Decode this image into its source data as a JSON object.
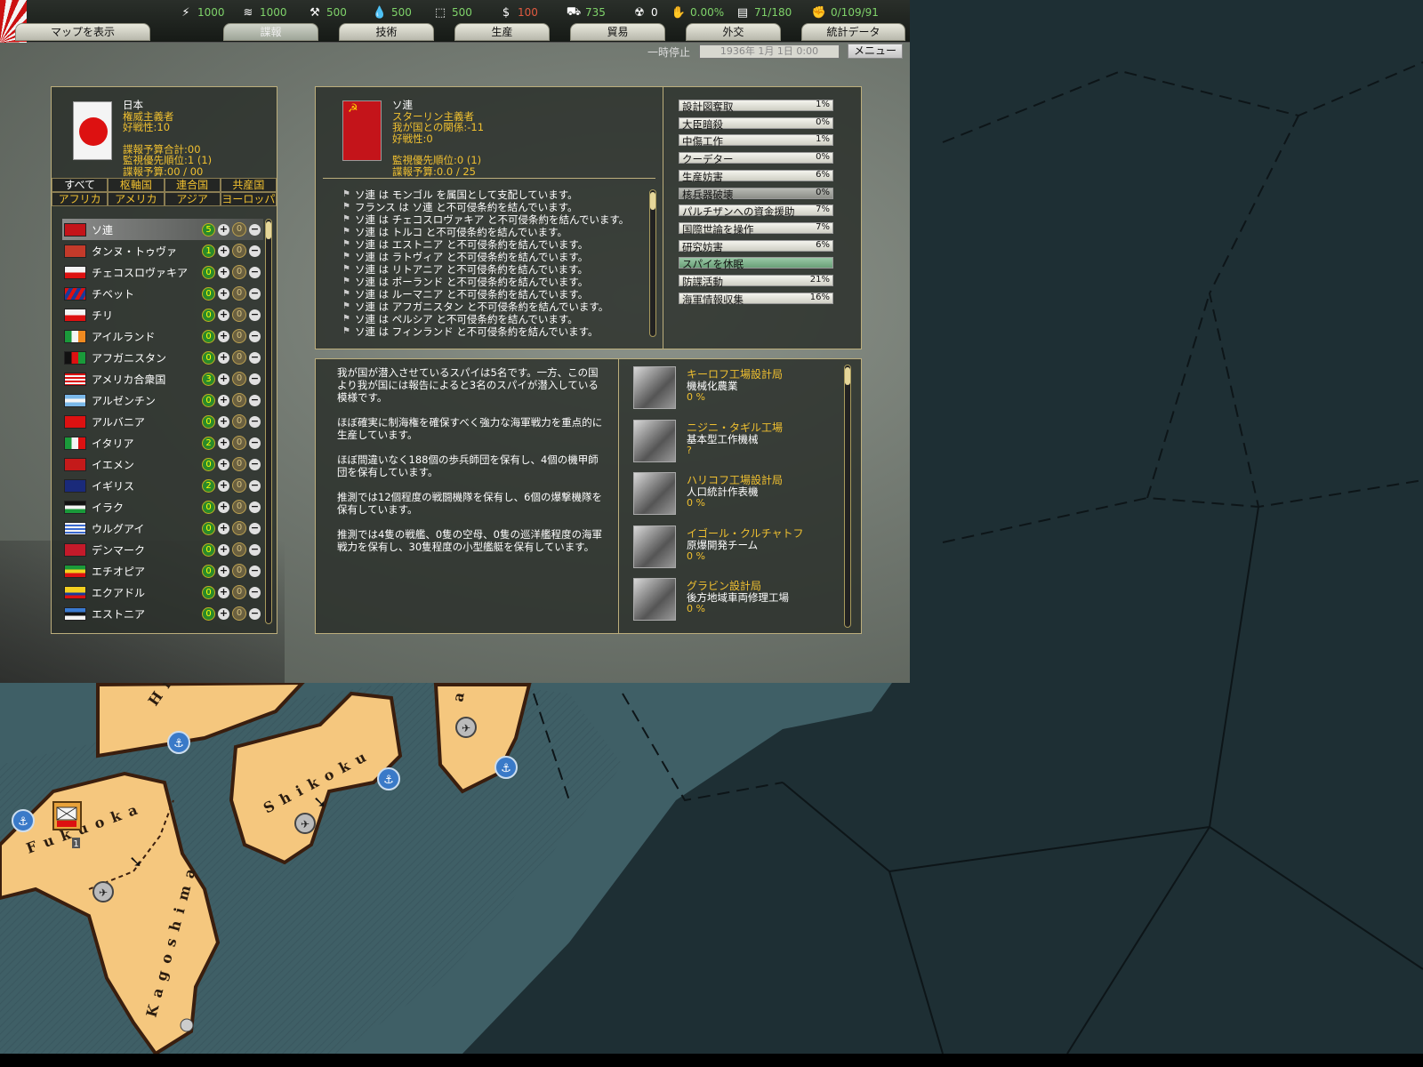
{
  "resources": [
    {
      "icon": "⚡",
      "name": "energy-icon",
      "value": "1000",
      "color": "green"
    },
    {
      "icon": "≋",
      "name": "metal-icon",
      "value": "1000",
      "color": "green"
    },
    {
      "icon": "⚒",
      "name": "rare-materials-icon",
      "value": "500",
      "color": "green"
    },
    {
      "icon": "💧",
      "name": "oil-icon",
      "value": "500",
      "color": "green"
    },
    {
      "icon": "⬚",
      "name": "supplies-icon",
      "value": "500",
      "color": "green"
    },
    {
      "icon": "$",
      "name": "money-icon",
      "value": "100",
      "color": "red"
    },
    {
      "icon": "⛟",
      "name": "manpower-icon",
      "value": "735",
      "color": "green"
    },
    {
      "icon": "☢",
      "name": "nuclear-icon",
      "value": "0",
      "color": "white"
    },
    {
      "icon": "✋",
      "name": "dissent-icon",
      "value": "0.00%",
      "color": "green"
    },
    {
      "icon": "▤",
      "name": "transport-icon",
      "value": "71/180",
      "color": "green"
    },
    {
      "icon": "✊",
      "name": "officers-icon",
      "value": "0/109/91",
      "color": "green"
    }
  ],
  "tabs": [
    "マップを表示",
    "諜報",
    "技術",
    "生産",
    "貿易",
    "外交",
    "統計データ"
  ],
  "subbar": {
    "pause": "一時停止",
    "date": "1936年 1月 1日 0:00",
    "menu": "メニュー"
  },
  "self": {
    "name": "日本",
    "ideology": "権威主義者",
    "belligerence": "好戦性:10",
    "budget_total": "諜報予算合計:00",
    "priority": "監視優先順位:1 (1)",
    "budget": "諜報予算:00 / 00"
  },
  "filters": [
    "すべて",
    "枢軸国",
    "連合国",
    "共産国",
    "アフリカ",
    "アメリカ",
    "アジア",
    "ヨーロッパ"
  ],
  "countries": [
    {
      "name": "ソ連",
      "spies": "5",
      "budget": "0",
      "selected": true,
      "flag": "linear-gradient(#c4141a,#c4141a)"
    },
    {
      "name": "タンヌ・トゥヴァ",
      "spies": "1",
      "budget": "0",
      "flag": "linear-gradient(#c43a2a,#c43a2a)"
    },
    {
      "name": "チェコスロヴァキア",
      "spies": "0",
      "budget": "0",
      "flag": "linear-gradient(#f4f4f4 50%,#d11 50%)"
    },
    {
      "name": "チベット",
      "spies": "0",
      "budget": "0",
      "flag": "repeating-linear-gradient(120deg,#d11 0 4px,#1a3a9a 4px 8px)"
    },
    {
      "name": "チリ",
      "spies": "0",
      "budget": "0",
      "flag": "linear-gradient(#f4f4f4 50%,#d11 50%)"
    },
    {
      "name": "アイルランド",
      "spies": "0",
      "budget": "0",
      "flag": "linear-gradient(90deg,#1a9a3a 33%,#f4f4f4 33% 66%,#f08a20 66%)"
    },
    {
      "name": "アフガニスタン",
      "spies": "0",
      "budget": "0",
      "flag": "linear-gradient(90deg,#111 33%,#d11 33% 66%,#1a9a3a 66%)"
    },
    {
      "name": "アメリカ合衆国",
      "spies": "3",
      "budget": "0",
      "flag": "repeating-linear-gradient(#d11 0 2px,#f4f4f4 2px 4px)"
    },
    {
      "name": "アルゼンチン",
      "spies": "0",
      "budget": "0",
      "flag": "linear-gradient(#7ab8e8 33%,#f4f4f4 33% 66%,#7ab8e8 66%)"
    },
    {
      "name": "アルバニア",
      "spies": "0",
      "budget": "0",
      "flag": "linear-gradient(#d11,#d11)"
    },
    {
      "name": "イタリア",
      "spies": "2",
      "budget": "0",
      "flag": "linear-gradient(90deg,#1a9a3a 33%,#f4f4f4 33% 66%,#d11 66%)"
    },
    {
      "name": "イエメン",
      "spies": "0",
      "budget": "0",
      "flag": "linear-gradient(#c41a1a,#c41a1a)"
    },
    {
      "name": "イギリス",
      "spies": "2",
      "budget": "0",
      "flag": "linear-gradient(#1a2a7a,#1a2a7a)"
    },
    {
      "name": "イラク",
      "spies": "0",
      "budget": "0",
      "flag": "linear-gradient(#111 33%,#f4f4f4 33% 66%,#1a9a3a 66%)"
    },
    {
      "name": "ウルグアイ",
      "spies": "0",
      "budget": "0",
      "flag": "repeating-linear-gradient(#f4f4f4 0 2px,#3a6ad0 2px 4px)"
    },
    {
      "name": "デンマーク",
      "spies": "0",
      "budget": "0",
      "flag": "linear-gradient(#c41a2a,#c41a2a)"
    },
    {
      "name": "エチオピア",
      "spies": "0",
      "budget": "0",
      "flag": "linear-gradient(#1a9a3a 33%,#f4d020 33% 66%,#d11 66%)"
    },
    {
      "name": "エクアドル",
      "spies": "0",
      "budget": "0",
      "flag": "linear-gradient(#f4d020 50%,#1a3a9a 50% 75%,#d11 75%)"
    },
    {
      "name": "エストニア",
      "spies": "0",
      "budget": "0",
      "flag": "linear-gradient(#3a7ad0 33%,#111 33% 66%,#f4f4f4 66%)"
    }
  ],
  "target": {
    "name": "ソ連",
    "ideology": "スターリン主義者",
    "relation": "我が国との関係:-11",
    "belligerence": "好戦性:0",
    "priority": "監視優先順位:0 (1)",
    "budget": "諜報予算:0.0 / 25"
  },
  "events": [
    "ソ連 は モンゴル を属国として支配しています。",
    "フランス は ソ連 と不可侵条約を結んでいます。",
    "ソ連 は チェコスロヴァキア と不可侵条約を結んでいます。",
    "ソ連 は トルコ と不可侵条約を結んでいます。",
    "ソ連 は エストニア と不可侵条約を結んでいます。",
    "ソ連 は ラトヴィア と不可侵条約を結んでいます。",
    "ソ連 は リトアニア と不可侵条約を結んでいます。",
    "ソ連 は ポーランド と不可侵条約を結んでいます。",
    "ソ連 は ルーマニア と不可侵条約を結んでいます。",
    "ソ連 は アフガニスタン と不可侵条約を結んでいます。",
    "ソ連 は ペルシア と不可侵条約を結んでいます。",
    "ソ連 は フィンランド と不可侵条約を結んでいます。"
  ],
  "missions": [
    {
      "label": "設計図奪取",
      "value": "1%",
      "style": "normal"
    },
    {
      "label": "大臣暗殺",
      "value": "0%",
      "style": "normal"
    },
    {
      "label": "中傷工作",
      "value": "1%",
      "style": "normal"
    },
    {
      "label": "クーデター",
      "value": "0%",
      "style": "normal"
    },
    {
      "label": "生産妨害",
      "value": "6%",
      "style": "normal"
    },
    {
      "label": "核兵器破壊",
      "value": "0%",
      "style": "dark"
    },
    {
      "label": "パルチザンへの資金援助",
      "value": "7%",
      "style": "normal"
    },
    {
      "label": "国際世論を操作",
      "value": "7%",
      "style": "normal"
    },
    {
      "label": "研究妨害",
      "value": "6%",
      "style": "normal"
    },
    {
      "label": "スパイを休眠",
      "value": "",
      "style": "green"
    },
    {
      "label": "防諜活動",
      "value": "21%",
      "style": "normal"
    },
    {
      "label": "海軍情報収集",
      "value": "16%",
      "style": "normal"
    }
  ],
  "report": [
    "我が国が潜入させているスパイは5名です。一方、この国より我が国には報告によると3名のスパイが潜入している模様です。",
    "ほぼ確実に制海権を確保すべく強力な海軍戦力を重点的に生産しています。",
    "ほぼ間違いなく188個の歩兵師団を保有し、4個の機甲師団を保有しています。",
    "推測では12個程度の戦闘機隊を保有し、6個の爆撃機隊を保有しています。",
    "推測では4隻の戦艦、0隻の空母、0隻の巡洋艦程度の海軍戦力を保有し、30隻程度の小型艦艇を保有しています。"
  ],
  "techs": [
    {
      "name": "キーロフ工場設計局",
      "desc": "機械化農業",
      "pct": "0 %"
    },
    {
      "name": "ニジニ・タギル工場",
      "desc": "基本型工作機械",
      "pct": "?"
    },
    {
      "name": "ハリコフ工場設計局",
      "desc": "人口統計作表機",
      "pct": "0 %"
    },
    {
      "name": "イゴール・クルチャトフ",
      "desc": "原爆開発チーム",
      "pct": "0 %"
    },
    {
      "name": "グラビン設計局",
      "desc": "後方地域車両修理工場",
      "pct": "0 %"
    }
  ],
  "map": {
    "labels": [
      "Hi",
      "Fukuoka",
      "Shikoku",
      "Kagoshima",
      "a"
    ],
    "unit_count": "1"
  }
}
